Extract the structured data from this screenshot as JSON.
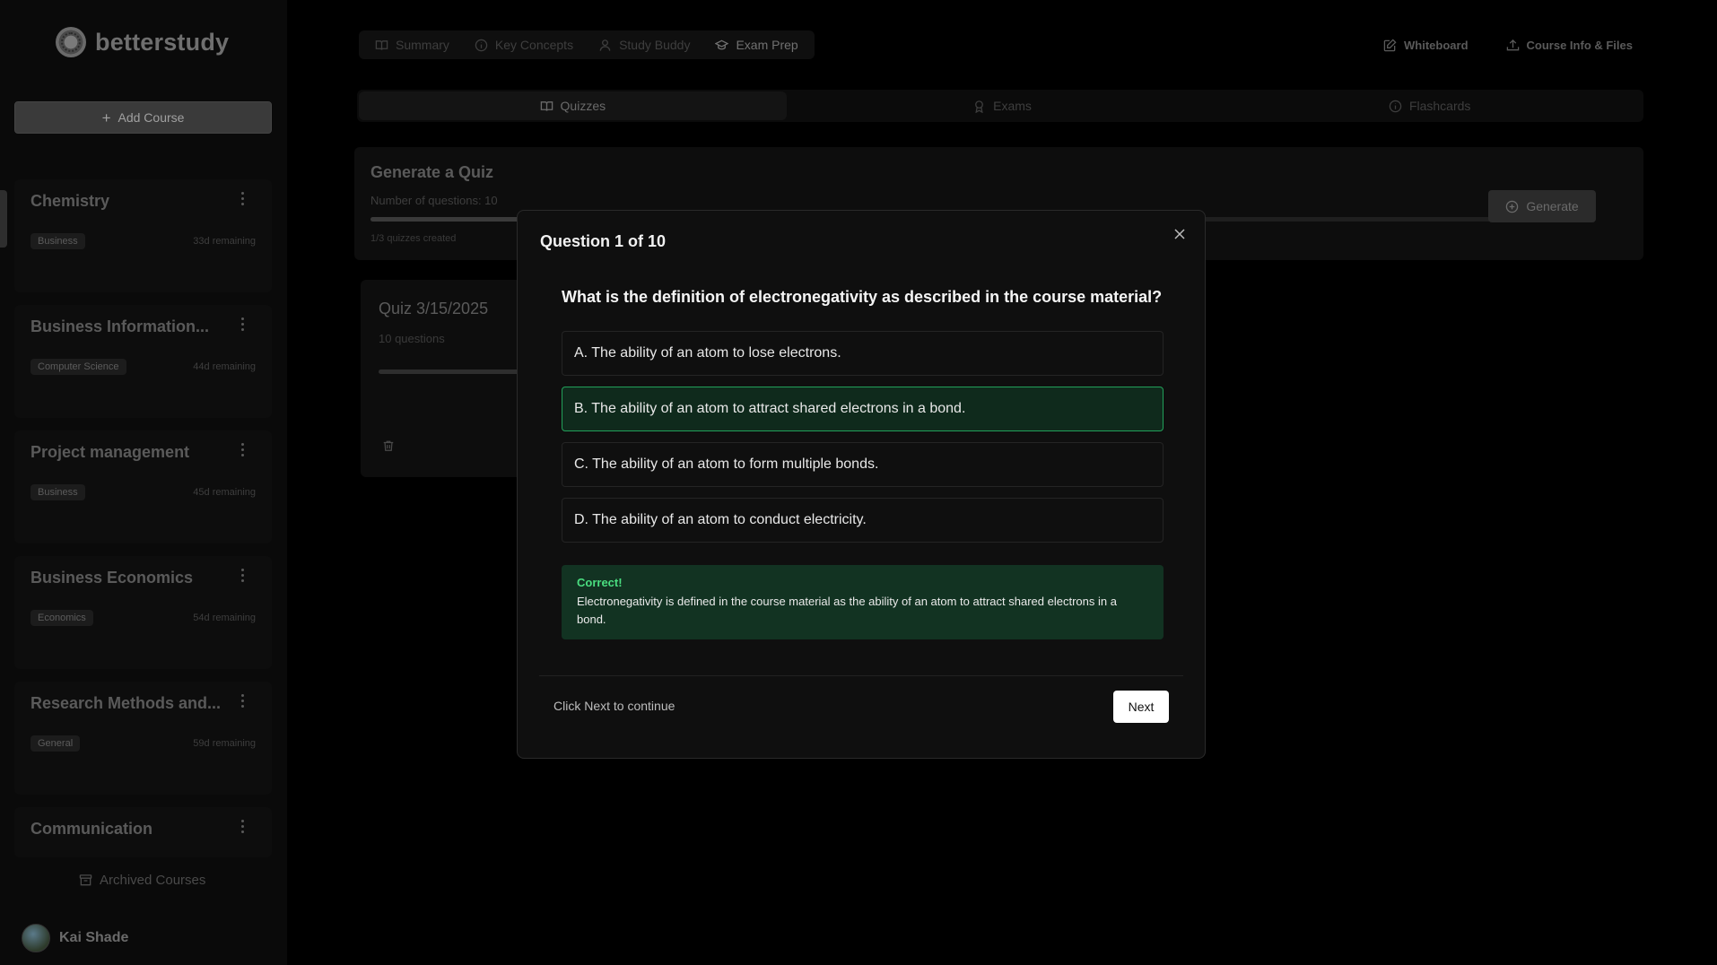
{
  "app": {
    "name": "betterstudy"
  },
  "sidebar": {
    "add_course_label": "Add Course",
    "courses": [
      {
        "name": "Chemistry",
        "tag": "Business",
        "remaining": "33d remaining"
      },
      {
        "name": "Business Information...",
        "tag": "Computer Science",
        "remaining": "44d remaining"
      },
      {
        "name": "Project management",
        "tag": "Business",
        "remaining": "45d remaining"
      },
      {
        "name": "Business Economics",
        "tag": "Economics",
        "remaining": "54d remaining"
      },
      {
        "name": "Research Methods and...",
        "tag": "General",
        "remaining": "59d remaining"
      },
      {
        "name": "Communication"
      }
    ],
    "archived_label": "Archived Courses",
    "user_name": "Kai Shade"
  },
  "topnav": {
    "tabs": [
      {
        "label": "Summary",
        "icon": "book-icon"
      },
      {
        "label": "Key Concepts",
        "icon": "info-icon"
      },
      {
        "label": "Study Buddy",
        "icon": "user-icon"
      },
      {
        "label": "Exam Prep",
        "icon": "graduation-cap-icon",
        "active": true
      }
    ],
    "whiteboard_label": "Whiteboard",
    "course_info_label": "Course Info & Files"
  },
  "subtabs": [
    {
      "label": "Quizzes",
      "active": true
    },
    {
      "label": "Exams"
    },
    {
      "label": "Flashcards"
    }
  ],
  "generate": {
    "title": "Generate a Quiz",
    "questions_label": "Number of questions: 10",
    "quizzes_created": "1/3 quizzes created",
    "button_label": "Generate"
  },
  "quiz_card": {
    "title": "Quiz 3/15/2025",
    "subtitle": "10 questions"
  },
  "modal": {
    "title": "Question 1 of 10",
    "question": "What is the definition of electronegativity as described in the course material?",
    "options": [
      "A. The ability of an atom to lose electrons.",
      "B. The ability of an atom to attract shared electrons in a bond.",
      "C. The ability of an atom to form multiple bonds.",
      "D. The ability of an atom to conduct electricity."
    ],
    "selected_option": 1,
    "feedback_heading": "Correct!",
    "feedback_text": "Electronegativity is defined in the course material as the ability of an atom to attract shared electrons in a bond.",
    "footer_hint": "Click Next to continue",
    "next_label": "Next"
  },
  "colors": {
    "correct_border": "#22a05a",
    "correct_bg": "#0f2a1c",
    "feedback_bg": "#123322",
    "feedback_heading": "#4ade80"
  }
}
